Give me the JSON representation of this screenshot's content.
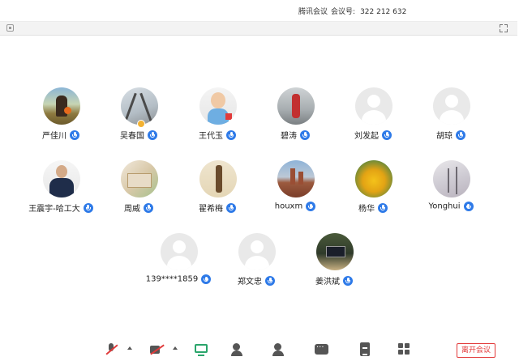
{
  "titlebar": {
    "app_name": "腾讯会议",
    "meeting_id_label": "会议号:",
    "meeting_id": "322 212 632"
  },
  "participants": [
    {
      "name": "严佳川",
      "avatar": "photo-man-with-ball"
    },
    {
      "name": "吴春国",
      "avatar": "photo-shadows"
    },
    {
      "name": "王代玉",
      "avatar": "photo-child"
    },
    {
      "name": "碧涛",
      "avatar": "photo-runner"
    },
    {
      "name": "刘发起",
      "avatar": "default"
    },
    {
      "name": "胡琼",
      "avatar": "default"
    },
    {
      "name": "王震宇-哈工大",
      "avatar": "photo-man-in-suit"
    },
    {
      "name": "周威",
      "avatar": "photo-document"
    },
    {
      "name": "翟希梅",
      "avatar": "photo-figure"
    },
    {
      "name": "houxm",
      "avatar": "photo-castle"
    },
    {
      "name": "杨华",
      "avatar": "photo-tulips"
    },
    {
      "name": "Yonghui",
      "avatar": "photo-winter-trees"
    },
    {
      "name": "139****1859",
      "avatar": "default"
    },
    {
      "name": "郑文忠",
      "avatar": "default"
    },
    {
      "name": "姜洪斌",
      "avatar": "photo-desk"
    }
  ],
  "bottombar": {
    "leave_label": "离开会议",
    "icons": [
      "mic-muted-icon",
      "video-off-icon",
      "share-screen-icon",
      "invite-icon",
      "members-icon",
      "chat-icon",
      "document-icon",
      "apps-icon"
    ]
  },
  "colors": {
    "mic_badge": "#2e7ae8",
    "leave_red": "#e23a3a",
    "share_green": "#2aa56b",
    "toolbar_bg": "#f3f3f3"
  }
}
